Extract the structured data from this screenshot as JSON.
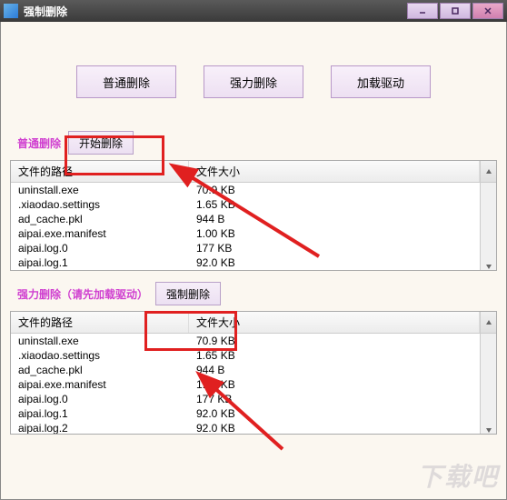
{
  "window": {
    "title": "强制删除",
    "minimize": "–",
    "maximize": "❐",
    "close": "✕"
  },
  "topButtons": {
    "normalDelete": "普通删除",
    "forceDelete": "强力删除",
    "loadDriver": "加载驱动"
  },
  "section1": {
    "label": "普通删除",
    "startBtn": "开始删除",
    "columns": {
      "path": "文件的路径",
      "size": "文件大小"
    },
    "rows": [
      {
        "path": "uninstall.exe",
        "size": "70.9 KB"
      },
      {
        "path": ".xiaodao.settings",
        "size": "1.65 KB"
      },
      {
        "path": "ad_cache.pkl",
        "size": "944 B"
      },
      {
        "path": "aipai.exe.manifest",
        "size": "1.00 KB"
      },
      {
        "path": "aipai.log.0",
        "size": "177 KB"
      },
      {
        "path": "aipai.log.1",
        "size": "92.0 KB"
      }
    ]
  },
  "section2": {
    "label": "强力删除（请先加载驱动）",
    "startBtn": "强制删除",
    "columns": {
      "path": "文件的路径",
      "size": "文件大小"
    },
    "rows": [
      {
        "path": "uninstall.exe",
        "size": "70.9 KB"
      },
      {
        "path": ".xiaodao.settings",
        "size": "1.65 KB"
      },
      {
        "path": "ad_cache.pkl",
        "size": "944 B"
      },
      {
        "path": "aipai.exe.manifest",
        "size": "1.00 KB"
      },
      {
        "path": "aipai.log.0",
        "size": "177 KB"
      },
      {
        "path": "aipai.log.1",
        "size": "92.0 KB"
      },
      {
        "path": "aipai.log.2",
        "size": "92.0 KB"
      }
    ]
  },
  "watermark": "下载吧"
}
